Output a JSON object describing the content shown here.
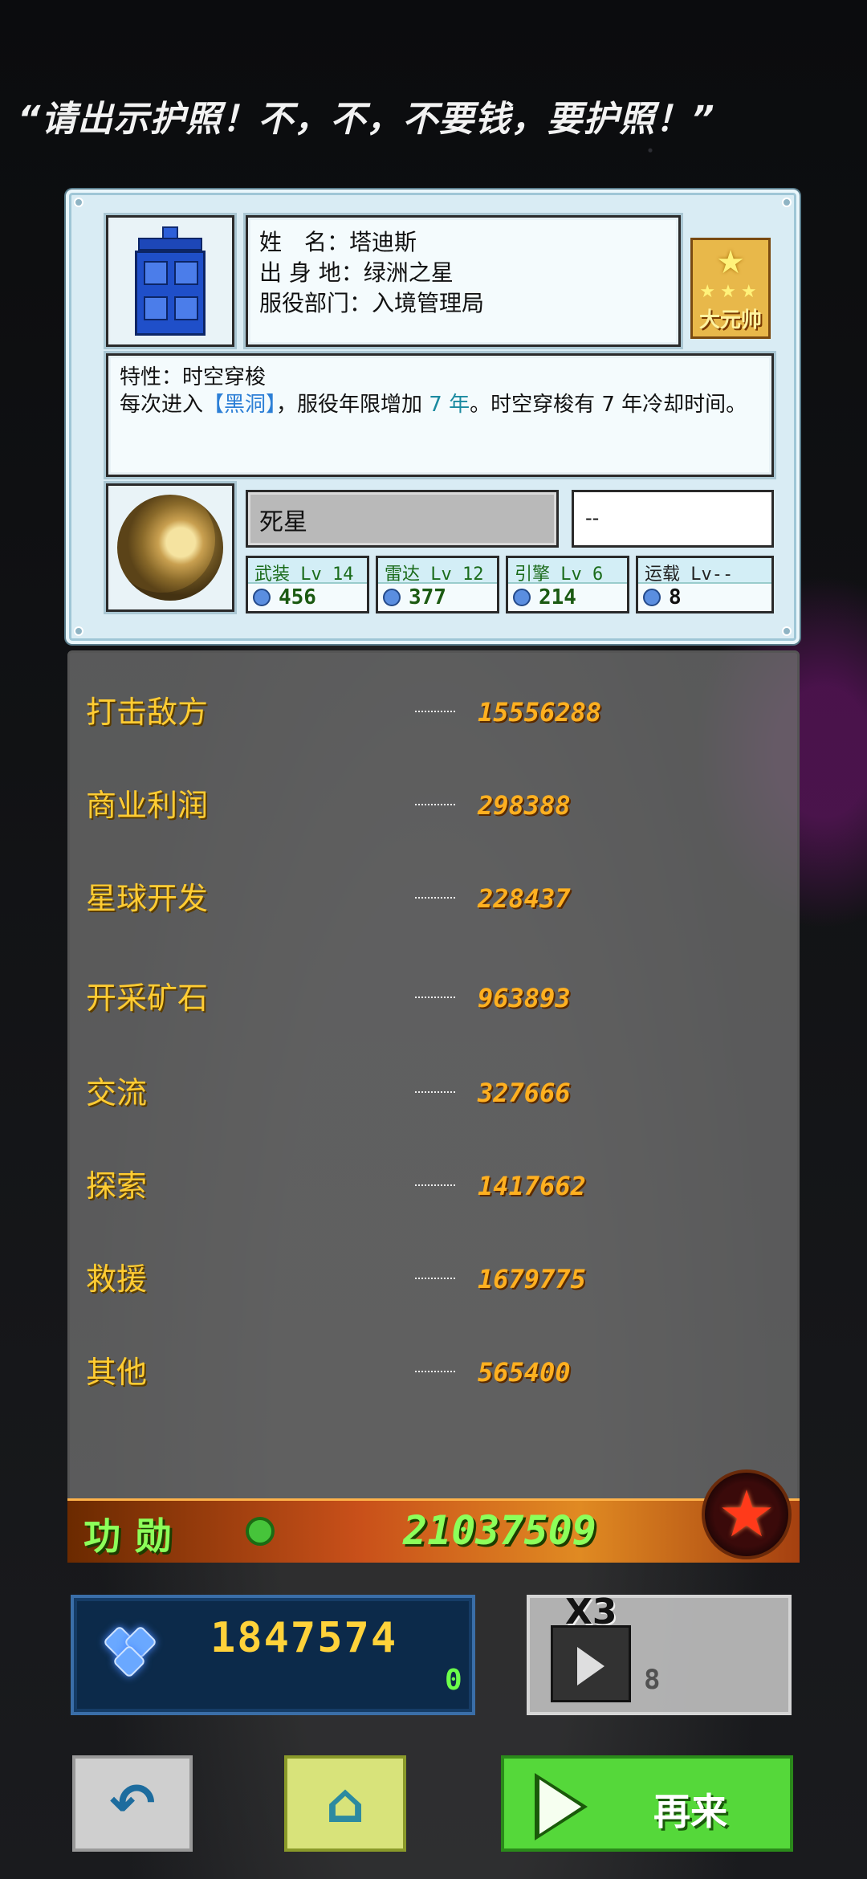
{
  "quote": "“请出示护照！不，不，不要钱，要护照！”",
  "profile": {
    "name_line": "姓　名：塔迪斯",
    "origin_line": "出 身 地：绿洲之星",
    "dept_line": "服役部门：入境管理局",
    "rank_label": "大元帅"
  },
  "trait": {
    "title": "特性：时空穿梭",
    "text_before": "每次进入",
    "highlight": "【黑洞】",
    "text_mid": "，服役年限增加 ",
    "years": "7 年",
    "text_after": "。时空穿梭有 7 年冷却时间。"
  },
  "ship": {
    "name": "死星",
    "extra": "--",
    "stats": [
      {
        "label": "武装  Lv 14",
        "value": "456"
      },
      {
        "label": "雷达  Lv 12",
        "value": "377"
      },
      {
        "label": "引擎  Lv 6",
        "value": "214"
      },
      {
        "label": "运载  Lv--",
        "value": "8"
      }
    ]
  },
  "merits": [
    {
      "label": "打击敌方",
      "value": "15556288"
    },
    {
      "label": "商业利润",
      "value": "298388"
    },
    {
      "label": "星球开发",
      "value": "228437"
    },
    {
      "label": "开采矿石",
      "value": "963893"
    },
    {
      "label": "交流",
      "value": "327666"
    },
    {
      "label": "探索",
      "value": "1417662"
    },
    {
      "label": "救援",
      "value": "1679775"
    },
    {
      "label": "其他",
      "value": "565400"
    }
  ],
  "merit_total": {
    "label": "功勋",
    "value": "21037509"
  },
  "gems": {
    "amount": "1847574",
    "gain": "0"
  },
  "ad": {
    "multiplier": "X3",
    "count": "8"
  },
  "buttons": {
    "again_label": "再来"
  },
  "icons": {
    "back": "back-arrow-icon",
    "home": "home-icon",
    "play": "play-icon",
    "badge": "red-star-badge-icon",
    "gem": "gem-cluster-icon",
    "video": "video-ad-icon",
    "ribbon": "medal-ribbon-icon"
  },
  "colors": {
    "merit_label": "#ffcc33",
    "merit_value": "#ffb020",
    "total": "#8cff5a",
    "again_button": "#55d83a"
  }
}
